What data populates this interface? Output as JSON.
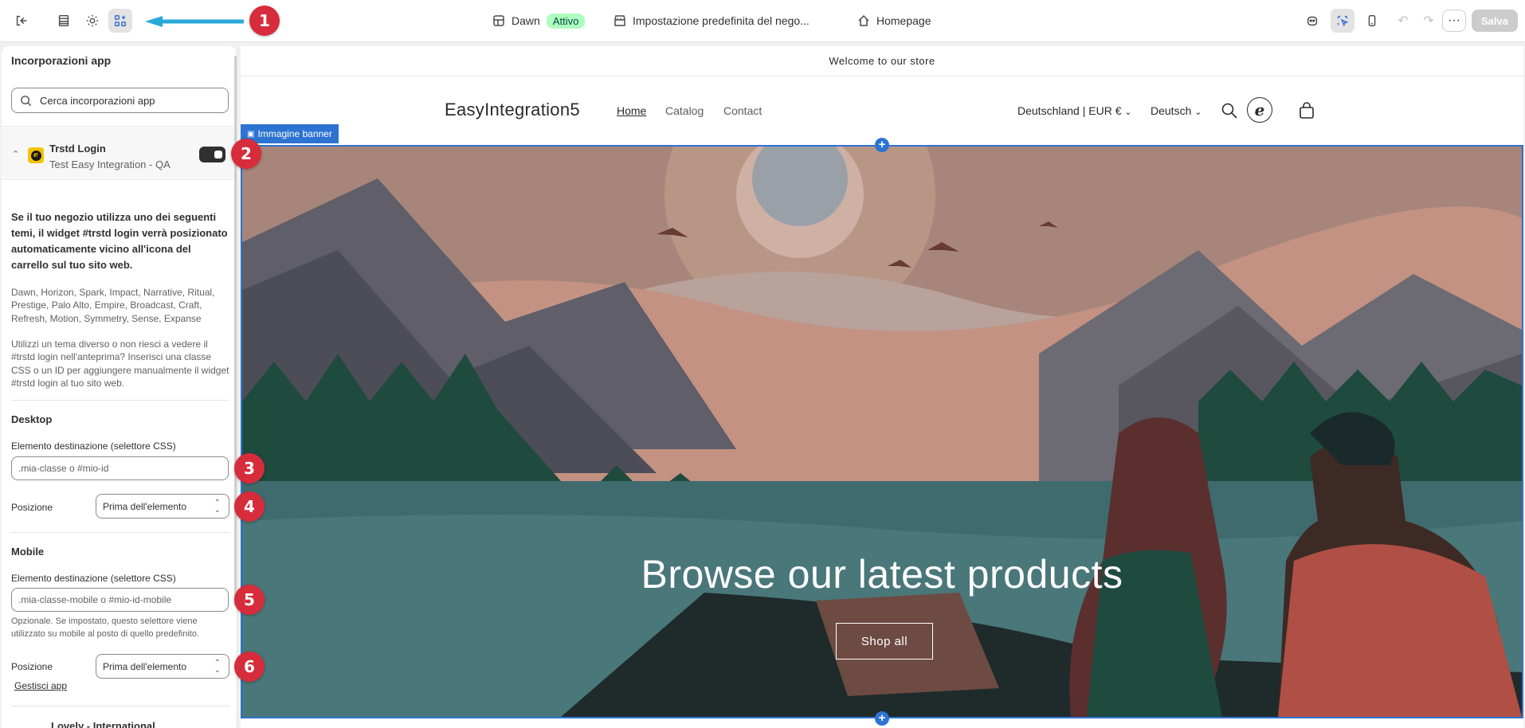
{
  "topbar": {
    "theme_name": "Dawn",
    "theme_status": "Attivo",
    "store_default": "Impostazione predefinita del nego...",
    "page": "Homepage",
    "save_label": "Salva",
    "more_label": "···"
  },
  "markers": [
    "1",
    "2",
    "3",
    "4",
    "5",
    "6"
  ],
  "sidebar": {
    "title": "Incorporazioni app",
    "search_placeholder": "Cerca incorporazioni app",
    "app": {
      "name": "Trstd Login",
      "subtitle": "Test Easy Integration - QA",
      "enabled": true
    },
    "intro_bold": "Se il tuo negozio utilizza uno dei seguenti temi, il widget #trstd login verrà posizionato automaticamente vicino all'icona del carrello sul tuo sito web.",
    "themes_list": "Dawn, Horizon, Spark, Impact, Narrative, Ritual, Prestige, Palo Alto, Empire, Broadcast, Craft, Refresh, Motion, Symmetry, Sense, Expanse",
    "custom_note": "Utilizzi un tema diverso o non riesci a vedere il #trstd login nell'anteprima? Inserisci una classe CSS o un ID per aggiungere manualmente il widget #trstd login al tuo sito web.",
    "desktop": {
      "heading": "Desktop",
      "target_label": "Elemento destinazione (selettore CSS)",
      "target_placeholder": ".mia-classe o #mio-id",
      "position_label": "Posizione",
      "position_value": "Prima dell'elemento"
    },
    "mobile": {
      "heading": "Mobile",
      "target_label": "Elemento destinazione (selettore CSS)",
      "target_placeholder": ".mia-classe-mobile o #mio-id-mobile",
      "hint": "Opzionale. Se impostato, questo selettore viene utilizzato su mobile al posto di quello predefinito.",
      "position_label": "Posizione",
      "position_value": "Prima dell'elemento"
    },
    "manage_link": "Gestisci app",
    "next_app": "Lovely - International"
  },
  "preview": {
    "announcement": "Welcome to our store",
    "store_name": "EasyIntegration5",
    "nav": [
      "Home",
      "Catalog",
      "Contact"
    ],
    "country": "Deutschland | EUR €",
    "language": "Deutsch",
    "banner_tag": "Immagine banner",
    "hero_title": "Browse our latest products",
    "hero_button": "Shop all",
    "e_badge": "e"
  },
  "colors": {
    "accent": "#2c73d2",
    "marker": "#d72c3b",
    "arrow": "#29a9d8",
    "badge_bg": "#affebf"
  }
}
